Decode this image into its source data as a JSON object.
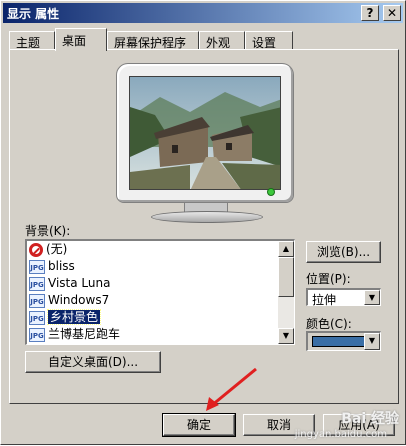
{
  "window": {
    "title": "显示 属性",
    "help_btn": "?",
    "close_btn": "✕"
  },
  "tabs": [
    "主题",
    "桌面",
    "屏幕保护程序",
    "外观",
    "设置"
  ],
  "active_tab": "桌面",
  "background": {
    "label": "背景(K):",
    "items": [
      {
        "label": "(无)",
        "icon": "none-icon"
      },
      {
        "label": "bliss",
        "icon": "jpg-icon"
      },
      {
        "label": "Vista Luna",
        "icon": "jpg-icon"
      },
      {
        "label": "Windows7",
        "icon": "jpg-icon"
      },
      {
        "label": "乡村景色",
        "icon": "jpg-icon",
        "selected": true
      },
      {
        "label": "兰博基尼跑车",
        "icon": "jpg-icon"
      }
    ],
    "icon_text": "JPG"
  },
  "buttons": {
    "browse": "浏览(B)...",
    "customize": "自定义桌面(D)...",
    "ok": "确定",
    "cancel": "取消",
    "apply": "应用(A)"
  },
  "position": {
    "label": "位置(P):",
    "value": "拉伸"
  },
  "color": {
    "label": "颜色(C):",
    "value": "#3a6ea5"
  },
  "watermark": {
    "main": "Bai 经验",
    "sub": "jingyan.baidu.com"
  },
  "colors": {
    "face": "#d4d0c8",
    "title_start": "#0a246a",
    "title_end": "#a6caf0",
    "selection": "#0a246a"
  }
}
